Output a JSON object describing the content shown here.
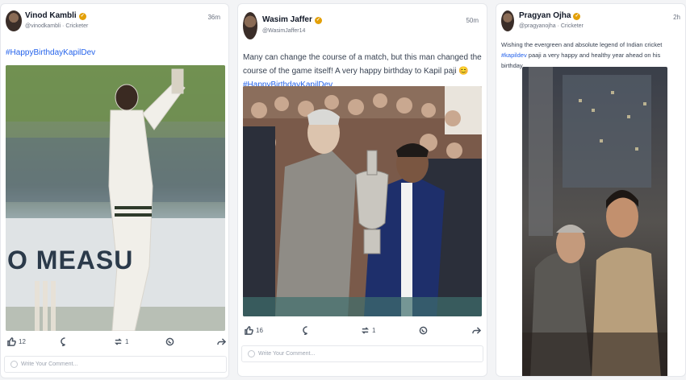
{
  "posts": [
    {
      "author": "Vinod Kambli",
      "handle": "@vinodkambli",
      "role": "Cricketer",
      "time": "36m",
      "text": "#HappyBirthdayKapilDev",
      "image_text": "O MEASU",
      "likes": "12",
      "retweets": "1",
      "comment_placeholder": "Write Your Comment..."
    },
    {
      "author": "Wasim Jaffer",
      "handle": "@WasimJaffer14",
      "time": "50m",
      "text": "Many can change the course of a match, but this man changed the course of the game itself! A very happy birthday to Kapil paji",
      "emoji": "😊",
      "hashtag": "#HappyBirthdayKapilDev",
      "likes": "16",
      "retweets": "1",
      "comment_placeholder": "Write Your Comment..."
    },
    {
      "author": "Pragyan Ojha",
      "handle": "@pragyanojha",
      "role": "Cricketer",
      "time": "2h",
      "text_before": "Wishing the evergreen and absolute legend of Indian cricket ",
      "mention": "#kapildev",
      "text_after": " paaji a very happy and healthy year ahead on his birthday."
    }
  ],
  "colors": {
    "accent": "#2563eb",
    "verified": "#e3a008"
  },
  "icons": [
    "like-icon",
    "comment-icon",
    "retweet-icon",
    "whatsapp-icon",
    "share-icon",
    "verified-icon"
  ]
}
